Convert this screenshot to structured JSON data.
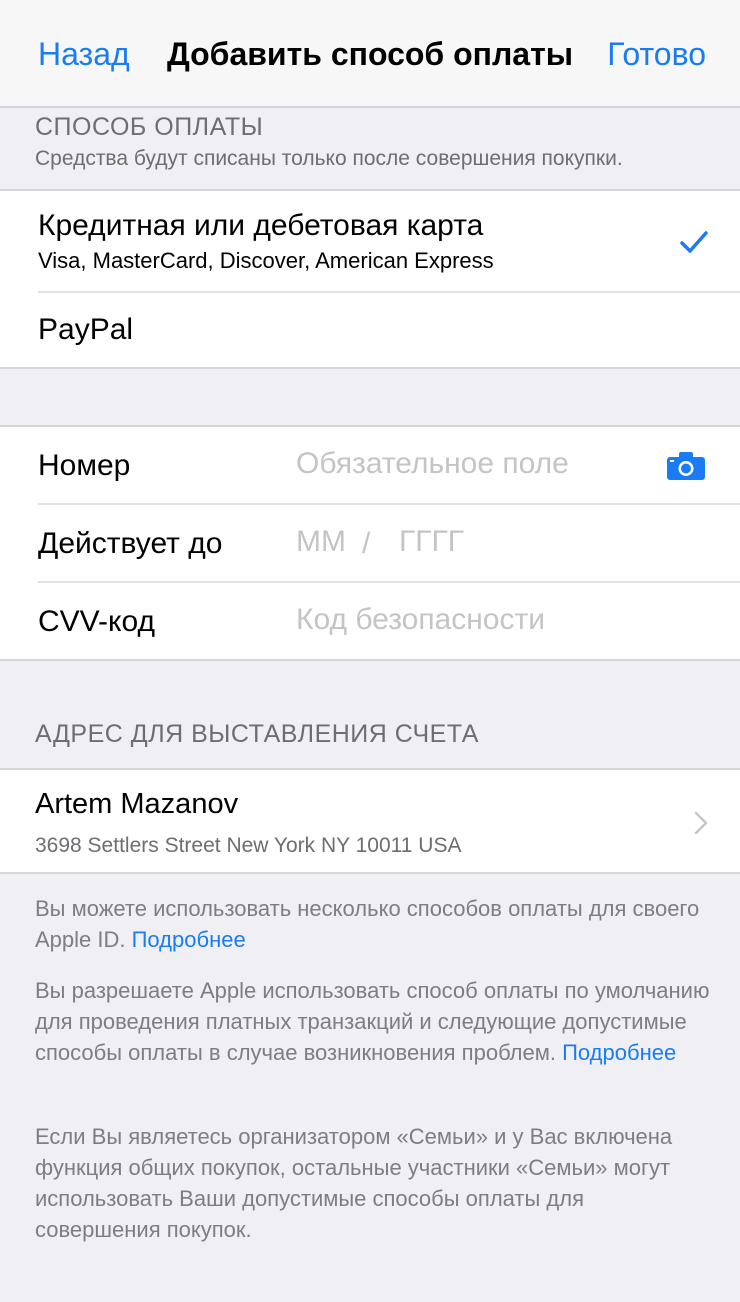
{
  "nav": {
    "back_label": "Назад",
    "title": "Добавить способ оплаты",
    "done_label": "Готово",
    "accent_color": "#1a7cf4"
  },
  "payment_method": {
    "header": "СПОСОБ ОПЛАТЫ",
    "subheader": "Средства будут списаны только после совершения покупки.",
    "options": [
      {
        "title": "Кредитная или дебетовая карта",
        "subtitle": "Visa, MasterCard, Discover, American Express",
        "selected": true,
        "icon": "checkmark-icon"
      },
      {
        "title": "PayPal",
        "selected": false
      }
    ]
  },
  "card_fields": {
    "number": {
      "label": "Номер",
      "placeholder": "Обязательное поле",
      "value": "",
      "icon": "camera-icon"
    },
    "expiry": {
      "label": "Действует до",
      "month_placeholder": "MM",
      "separator": "/",
      "year_placeholder": "ГГГГ"
    },
    "cvv": {
      "label": "CVV-код",
      "placeholder": "Код безопасности",
      "value": ""
    }
  },
  "billing": {
    "header": "АДРЕС ДЛЯ ВЫСТАВЛЕНИЯ СЧЕТА",
    "name": "Artem Mazanov",
    "address": "3698 Settlers Street New York NY 10011 USA",
    "icon": "chevron-right-icon"
  },
  "footer": {
    "p1_text": "Вы можете использовать несколько способов оплаты для своего Apple ID. ",
    "p1_link": "Подробнее",
    "p2_text": "Вы разрешаете Apple использовать способ оплаты по умолчанию для проведения платных транзакций и следующие допустимые способы оплаты в случае возникновения проблем. ",
    "p2_link": "Подробнее",
    "p3_text": "Если Вы являетесь организатором «Семьи» и у Вас включена функция общих покупок, остальные участники «Семьи» могут использовать Ваши допустимые способы оплаты для совершения покупок."
  }
}
